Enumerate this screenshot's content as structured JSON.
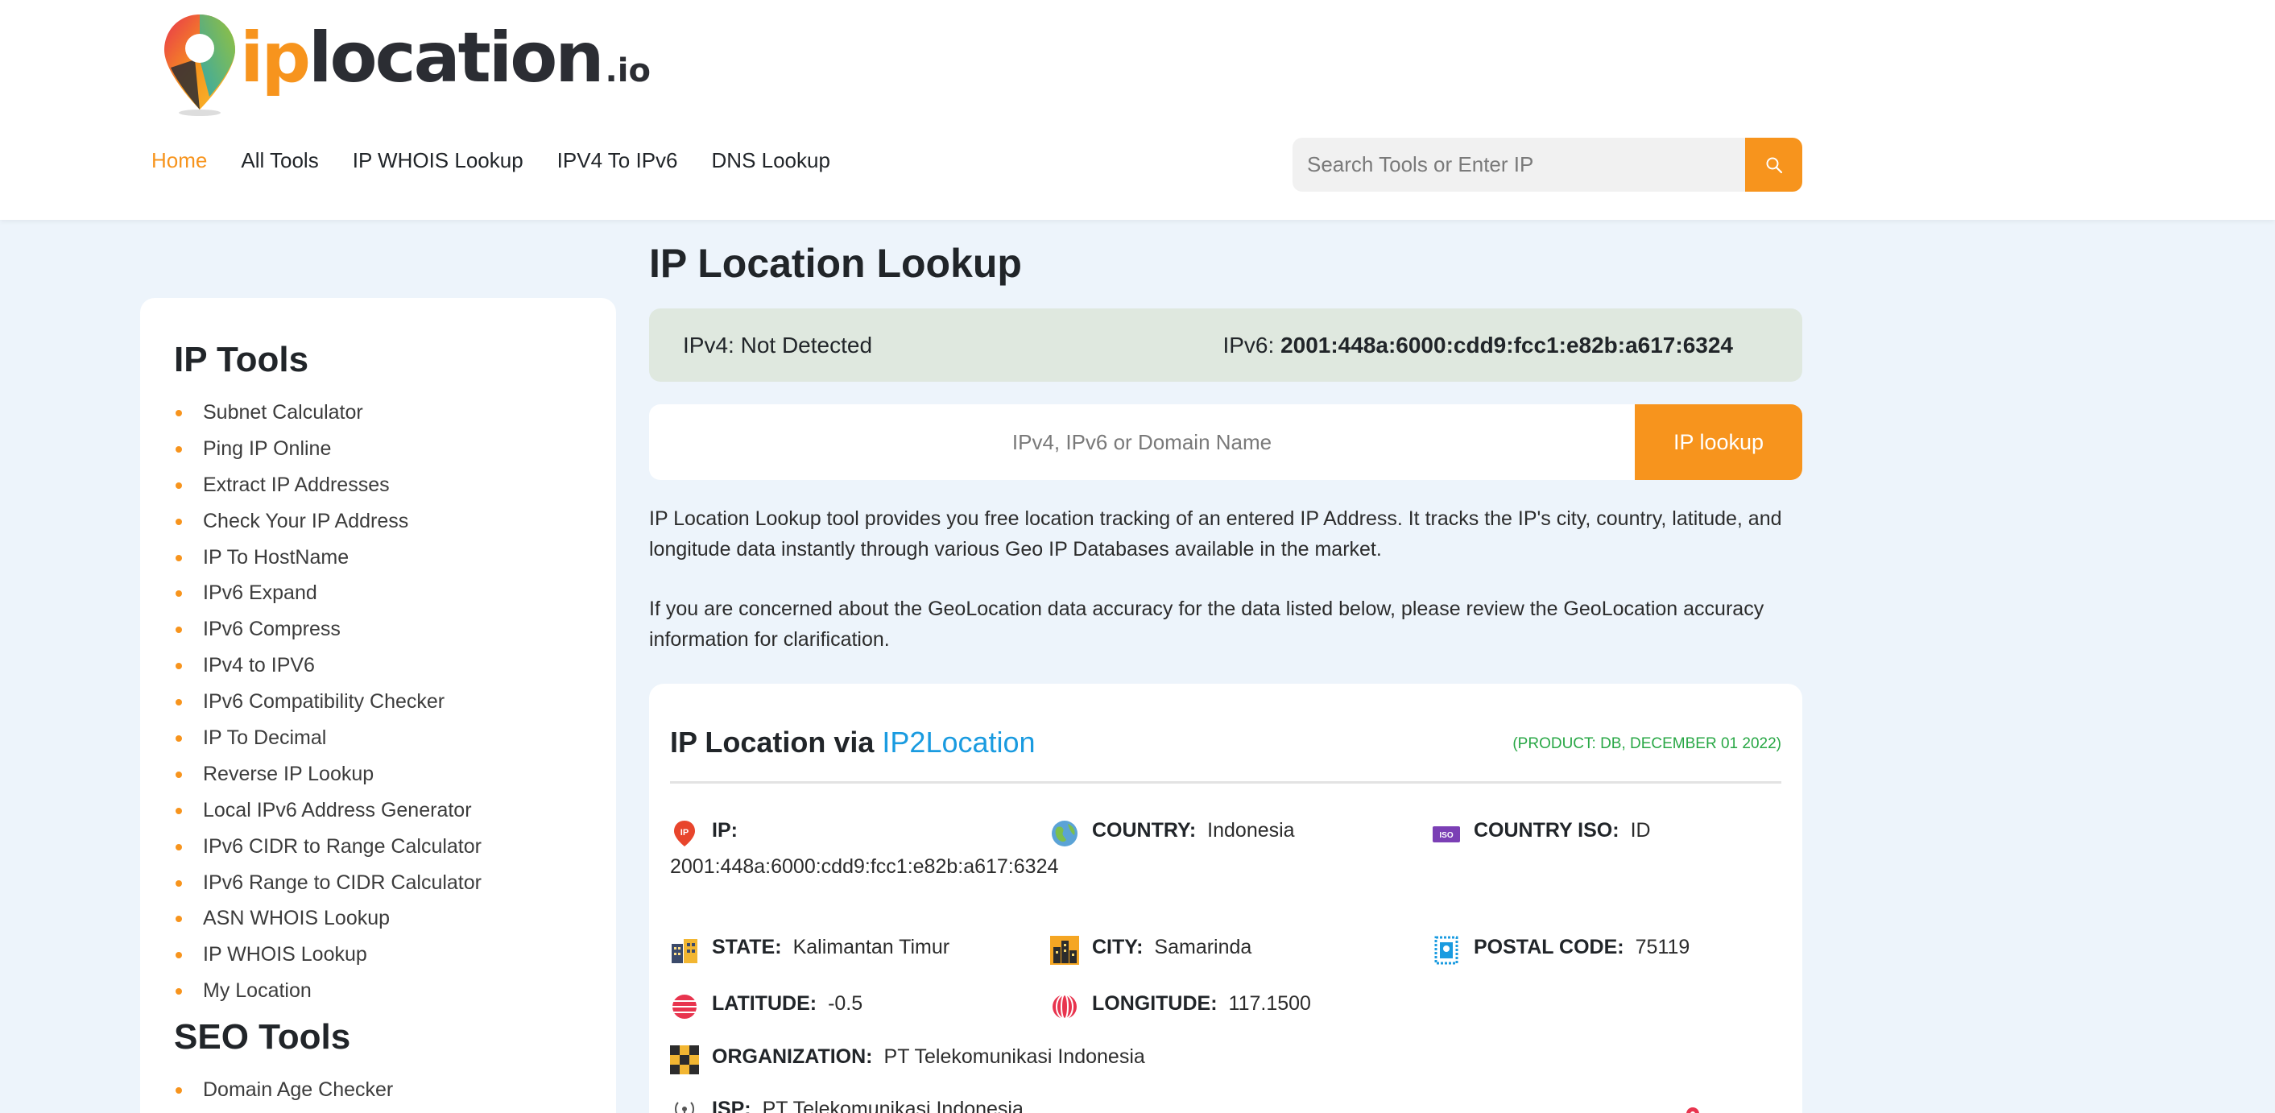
{
  "logo": {
    "ip": "ip",
    "location": "location",
    "io": ".io"
  },
  "nav": {
    "home": "Home",
    "all_tools": "All Tools",
    "whois": "IP WHOIS Lookup",
    "ipv4_to_ipv6": "IPV4 To IPv6",
    "dns": "DNS Lookup"
  },
  "search": {
    "placeholder": "Search Tools or Enter IP"
  },
  "sidebar": {
    "ip_tools_heading": "IP Tools",
    "ip_tools": [
      "Subnet Calculator",
      "Ping IP Online",
      "Extract IP Addresses",
      "Check Your IP Address",
      "IP To HostName",
      "IPv6 Expand",
      "IPv6 Compress",
      "IPv4 to IPV6",
      "IPv6 Compatibility Checker",
      "IP To Decimal",
      "Reverse IP Lookup",
      "Local IPv6 Address Generator",
      "IPv6 CIDR to Range Calculator",
      "IPv6 Range to CIDR Calculator",
      "ASN WHOIS Lookup",
      "IP WHOIS Lookup",
      "My Location"
    ],
    "seo_heading": "SEO Tools",
    "seo_tools": [
      "Domain Age Checker"
    ]
  },
  "main": {
    "title": "IP Location Lookup",
    "ipv4_label": "IPv4:",
    "ipv4_value": "Not Detected",
    "ipv6_label": "IPv6:",
    "ipv6_value": "2001:448a:6000:cdd9:fcc1:e82b:a617:6324",
    "lookup_placeholder": "IPv4, IPv6 or Domain Name",
    "lookup_button": "IP lookup",
    "desc1": "IP Location Lookup tool provides you free location tracking of an entered IP Address. It tracks the IP's city, country, latitude, and longitude data instantly through various Geo IP Databases available in the market.",
    "desc2": "If you are concerned about the GeoLocation data accuracy for the data listed below, please review the GeoLocation accuracy information for clarification."
  },
  "card": {
    "title_prefix": "IP Location via",
    "provider": "IP2Location",
    "product": "(PRODUCT: DB, DECEMBER 01 2022)",
    "fields": {
      "ip": {
        "label": "IP:",
        "value": "2001:448a:6000:cdd9:fcc1:e82b:a617:6324"
      },
      "country": {
        "label": "COUNTRY:",
        "value": "Indonesia"
      },
      "country_iso": {
        "label": "COUNTRY ISO:",
        "value": "ID"
      },
      "state": {
        "label": "STATE:",
        "value": "Kalimantan Timur"
      },
      "city": {
        "label": "CITY:",
        "value": "Samarinda"
      },
      "postal": {
        "label": "POSTAL CODE:",
        "value": "75119"
      },
      "latitude": {
        "label": "LATITUDE:",
        "value": "-0.5"
      },
      "longitude": {
        "label": "LONGITUDE:",
        "value": "117.1500"
      },
      "organization": {
        "label": "ORGANIZATION:",
        "value": "PT Telekomunikasi Indonesia"
      },
      "isp": {
        "label": "ISP:",
        "value": "PT Telekomunikasi Indonesia"
      }
    },
    "icons": {
      "ip": "ip-pin-icon",
      "country": "globe-icon",
      "country_iso": "iso-badge-icon",
      "state": "buildings-icon",
      "city": "city-icon",
      "postal": "stamp-icon",
      "latitude": "latitude-icon",
      "longitude": "longitude-icon",
      "organization": "organization-icon",
      "isp": "antenna-icon"
    }
  },
  "colors": {
    "accent": "#f7941d",
    "link": "#1a9be0",
    "success": "#28a745",
    "page_bg": "#edf4fb",
    "ipbar_bg": "#dfe8df"
  }
}
